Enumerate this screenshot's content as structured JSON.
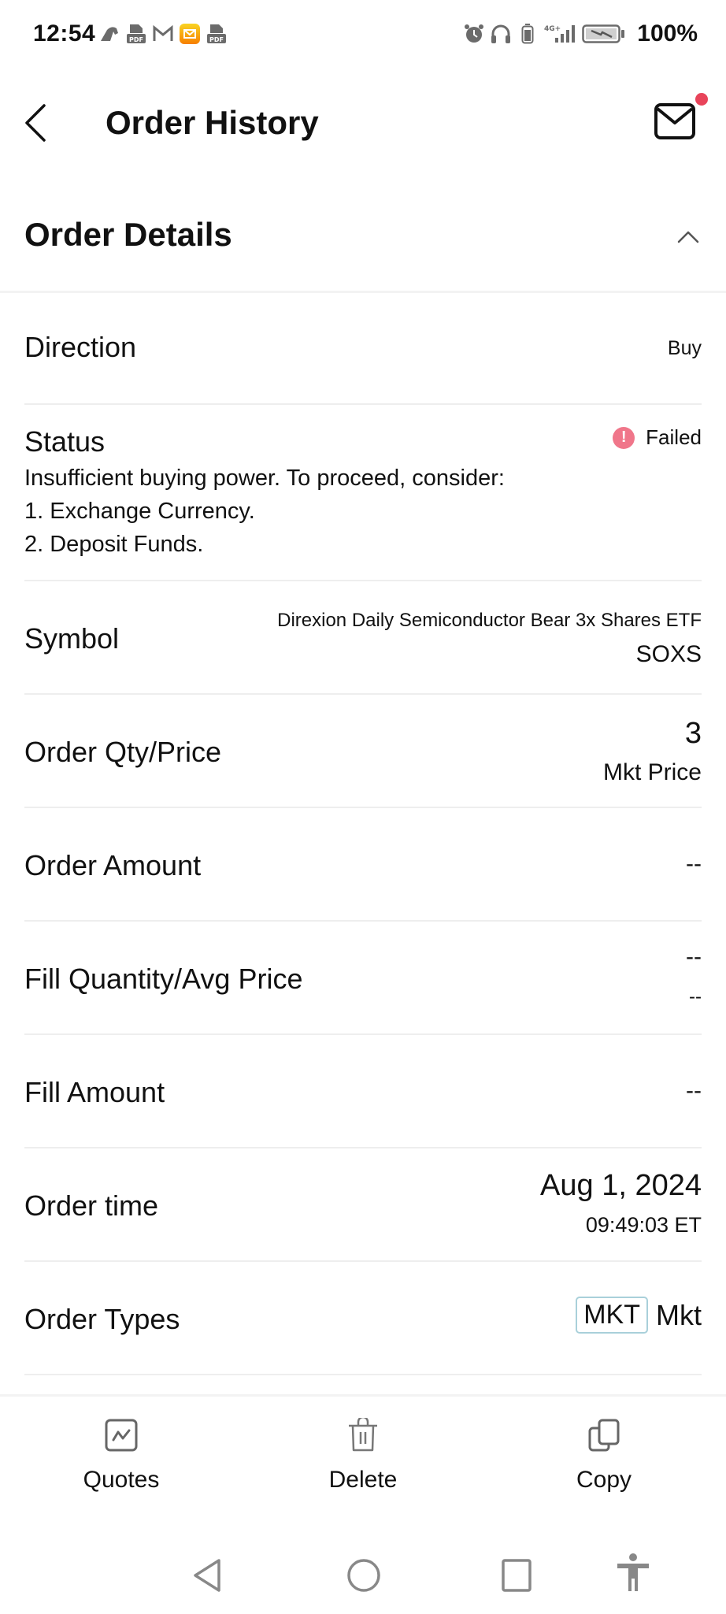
{
  "status_bar": {
    "time": "12:54",
    "left_icons": [
      "app-notification-icon",
      "pdf-icon",
      "gmail-icon",
      "mail-app-icon",
      "pdf-icon"
    ],
    "right_icons": [
      "alarm-icon",
      "headphones-icon",
      "battery-saver-icon",
      "signal-4g-plus-icon",
      "battery-charging-icon"
    ],
    "network_label": "4G+",
    "battery_percent": "100%"
  },
  "header": {
    "title": "Order History",
    "has_unread_messages": true,
    "unread_dot_color": "#e8445a"
  },
  "section": {
    "title": "Order Details",
    "expanded": true
  },
  "rows": {
    "direction": {
      "label": "Direction",
      "value": "Buy"
    },
    "status": {
      "label": "Status",
      "value": "Failed",
      "status_color": "#f0768a",
      "message_lines": [
        "Insufficient buying power. To proceed, consider:",
        "1. Exchange Currency.",
        "2. Deposit Funds."
      ]
    },
    "symbol": {
      "label": "Symbol",
      "name": "Direxion Daily Semiconductor Bear 3x Shares ETF",
      "ticker": "SOXS"
    },
    "order_qty_price": {
      "label": "Order Qty/Price",
      "qty": "3",
      "price": "Mkt Price"
    },
    "order_amount": {
      "label": "Order Amount",
      "value": "--"
    },
    "fill_qty_avg_price": {
      "label": "Fill Quantity/Avg Price",
      "qty": "--",
      "avg_price": "--"
    },
    "fill_amount": {
      "label": "Fill Amount",
      "value": "--"
    },
    "order_time": {
      "label": "Order time",
      "date": "Aug 1, 2024",
      "time": "09:49:03 ET"
    },
    "order_types": {
      "label": "Order Types",
      "badge": "MKT",
      "value": "Mkt"
    }
  },
  "actions": {
    "quotes": "Quotes",
    "delete": "Delete",
    "copy": "Copy"
  },
  "nav": [
    "back",
    "home",
    "recents",
    "accessibility"
  ]
}
